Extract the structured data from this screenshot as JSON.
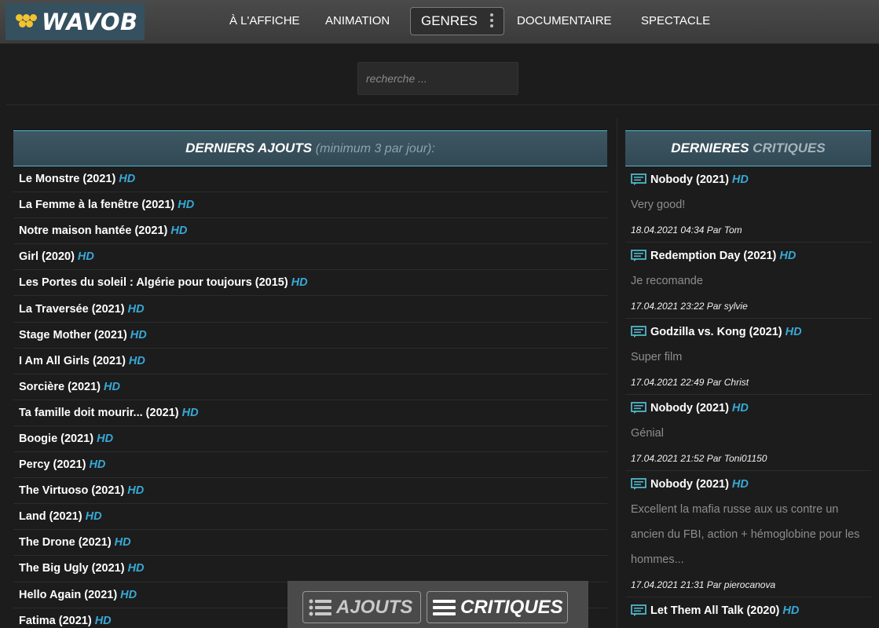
{
  "brand": {
    "name": "WAVOB",
    "logo_color": "#f2c230",
    "accent": "#37a9d6"
  },
  "nav": {
    "items": [
      "À L'AFFICHE",
      "ANIMATION",
      "DOCUMENTAIRE",
      "SPECTACLE"
    ],
    "genres_label": "GENRES",
    "genres_icon": "more-vertical-icon"
  },
  "search": {
    "placeholder": "recherche ..."
  },
  "latest": {
    "heading": "DERNIERS AJOUTS",
    "subheading": "(minimum 3 par jour):",
    "hd_label": "HD",
    "items": [
      "Le Monstre (2021)",
      "La Femme à la fenêtre (2021)",
      "Notre maison hantée (2021)",
      "Girl (2020)",
      "Les Portes du soleil : Algérie pour toujours (2015)",
      "La Traversée (2021)",
      "Stage Mother (2021)",
      "I Am All Girls (2021)",
      "Sorcière (2021)",
      "Ta famille doit mourir... (2021)",
      "Boogie (2021)",
      "Percy (2021)",
      "The Virtuoso (2021)",
      "Land (2021)",
      "The Drone (2021)",
      "The Big Ugly (2021)",
      "Hello Again (2021)",
      "Fatima (2021)"
    ]
  },
  "reviews": {
    "heading_main": "DERNIERES",
    "heading_sub": "CRITIQUES",
    "items": [
      {
        "title": "Nobody (2021)",
        "text": "Very good!",
        "meta": "18.04.2021 04:34 Par Tom"
      },
      {
        "title": "Redemption Day (2021)",
        "text": "Je recomande",
        "meta": "17.04.2021 23:22 Par sylvie"
      },
      {
        "title": "Godzilla vs. Kong (2021)",
        "text": "Super film",
        "meta": "17.04.2021 22:49 Par Christ"
      },
      {
        "title": "Nobody (2021)",
        "text": "Génial",
        "meta": "17.04.2021 21:52 Par Toni01150"
      },
      {
        "title": "Nobody (2021)",
        "text": "Excellent la mafia russe aux us contre un ancien du FBI, action + hémoglobine pour les hommes...",
        "meta": "17.04.2021 21:31 Par pierocanova"
      },
      {
        "title": "Let Them All Talk (2020)",
        "text": "",
        "meta": ""
      }
    ]
  },
  "floatbar": {
    "ajouts_label": "AJOUTS",
    "critiques_label": "CRITIQUES"
  }
}
